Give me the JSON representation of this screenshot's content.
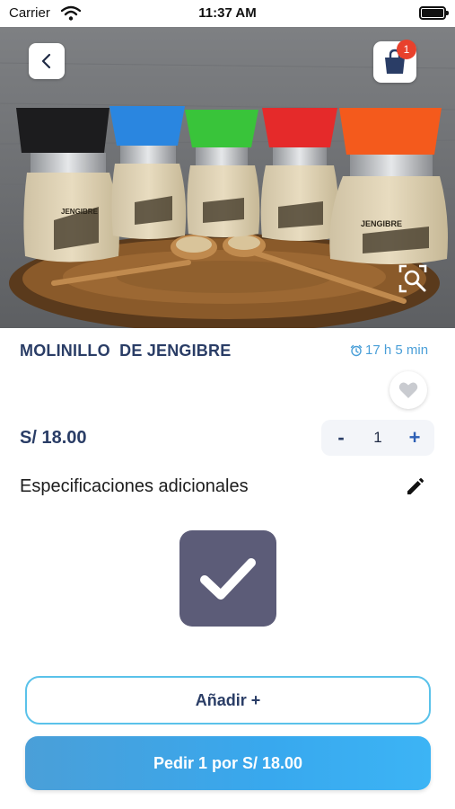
{
  "status_bar": {
    "carrier": "Carrier",
    "time": "11:37 AM"
  },
  "header": {
    "back_icon": "chevron-left-icon",
    "cart_icon": "shopping-bag-icon",
    "cart_count": "1",
    "zoom_icon": "zoom-search-icon"
  },
  "product": {
    "name": "MOLINILLO  DE JENGIBRE",
    "timer": "17 h 5 min",
    "timer_icon": "alarm-clock-icon",
    "favorite_icon": "heart-icon",
    "price": "S/ 18.00",
    "image_labels": {
      "jar_label_left": "JENGIBRE",
      "jar_label_right": "JENGIBRE"
    }
  },
  "quantity": {
    "minus": "-",
    "value": "1",
    "plus": "+"
  },
  "specs": {
    "label": "Especificaciones adicionales",
    "edit_icon": "pencil-icon"
  },
  "checkbox": {
    "checked": true,
    "icon": "checkmark-icon"
  },
  "actions": {
    "add_label": "Añadir +",
    "order_label": "Pedir 1 por S/ 18.00"
  },
  "colors": {
    "primary_text": "#2a3d66",
    "accent_blue": "#4a9fd8",
    "badge_red": "#e8412c",
    "check_bg": "#5c5c78"
  }
}
